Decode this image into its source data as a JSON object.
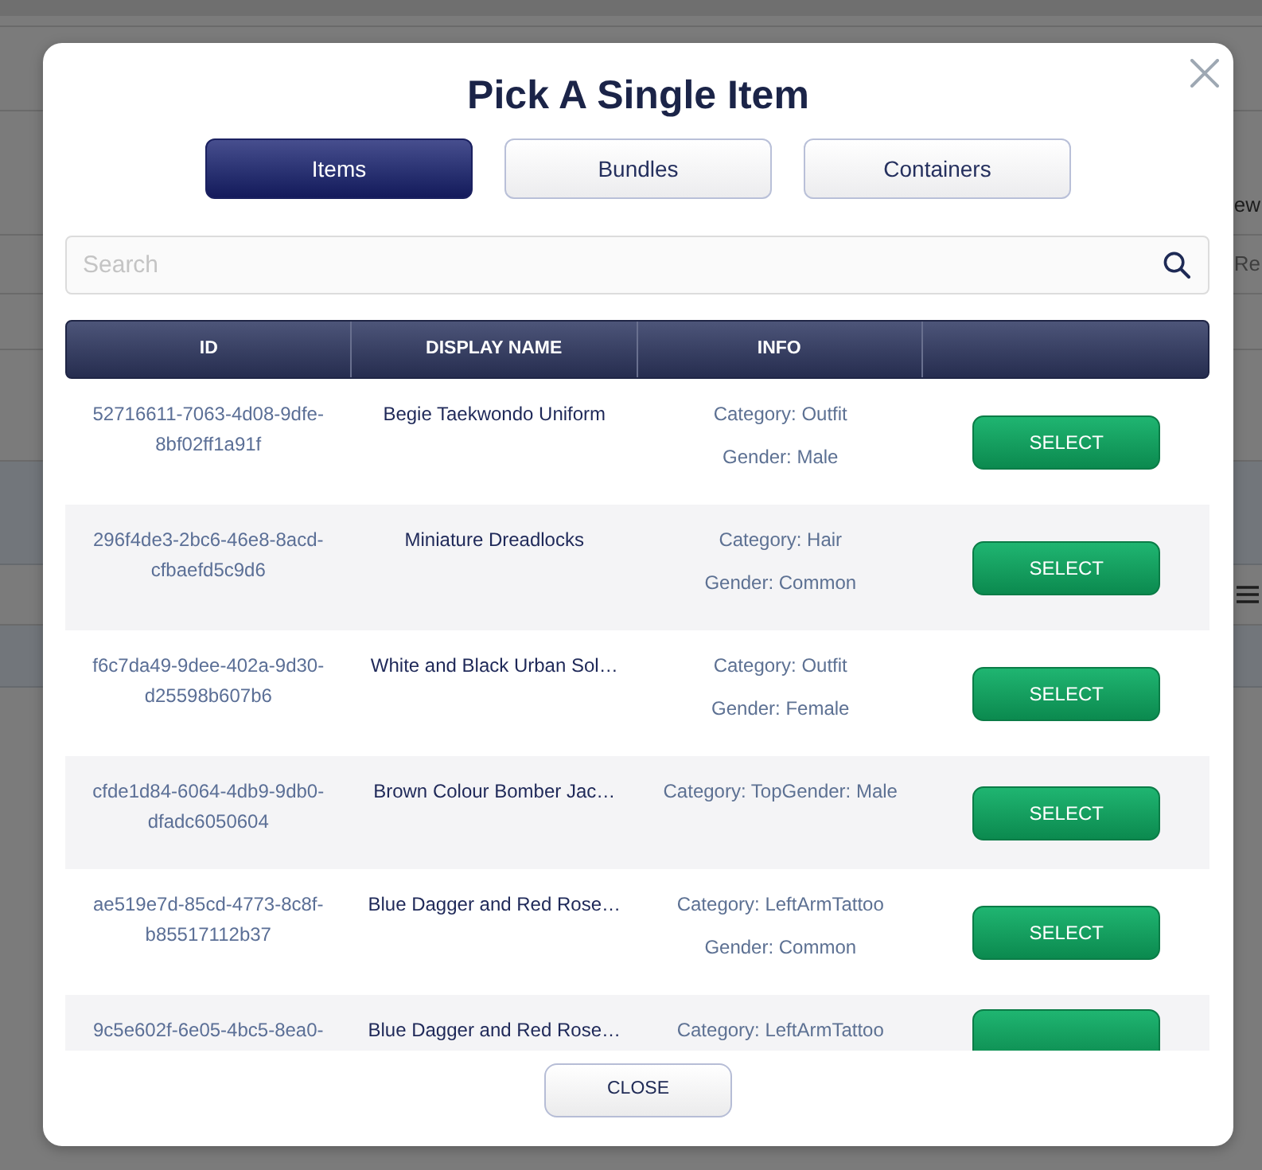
{
  "background_page": {
    "column_header": "ew",
    "field_placeholder": "Re"
  },
  "dialog": {
    "title": "Pick A Single Item",
    "tabs": [
      {
        "label": "Items",
        "selected": true
      },
      {
        "label": "Bundles",
        "selected": false
      },
      {
        "label": "Containers",
        "selected": false
      }
    ],
    "search": {
      "placeholder": "Search"
    },
    "table": {
      "columns": [
        "ID",
        "DISPLAY NAME",
        "INFO"
      ],
      "rows": [
        {
          "id": "52716611-7063-4d08-9dfe-8bf02ff1a91f",
          "display_name": "Begie Taekwondo Uniform",
          "info": [
            "Category: Outfit",
            "Gender: Male"
          ],
          "action": "SELECT"
        },
        {
          "id": "296f4de3-2bc6-46e8-8acd-cfbaefd5c9d6",
          "display_name": "Miniature Dreadlocks",
          "info": [
            "Category: Hair",
            "Gender: Common"
          ],
          "action": "SELECT"
        },
        {
          "id": "f6c7da49-9dee-402a-9d30-d25598b607b6",
          "display_name": "White and Black Urban Sol…",
          "info": [
            "Category: Outfit",
            "Gender: Female"
          ],
          "action": "SELECT"
        },
        {
          "id": "cfde1d84-6064-4db9-9db0-dfadc6050604",
          "display_name": "Brown Colour Bomber Jac…",
          "info": [
            "Category: TopGender: Male"
          ],
          "action": "SELECT"
        },
        {
          "id": "ae519e7d-85cd-4773-8c8f-b85517112b37",
          "display_name": "Blue Dagger and Red Rose…",
          "info": [
            "Category: LeftArmTattoo",
            "Gender: Common"
          ],
          "action": "SELECT"
        },
        {
          "id": "9c5e602f-6e05-4bc5-8ea0-",
          "display_name": "Blue Dagger and Red Rose…",
          "info": [
            "Category: LeftArmTattoo"
          ]
        }
      ]
    },
    "close_button": "CLOSE"
  }
}
